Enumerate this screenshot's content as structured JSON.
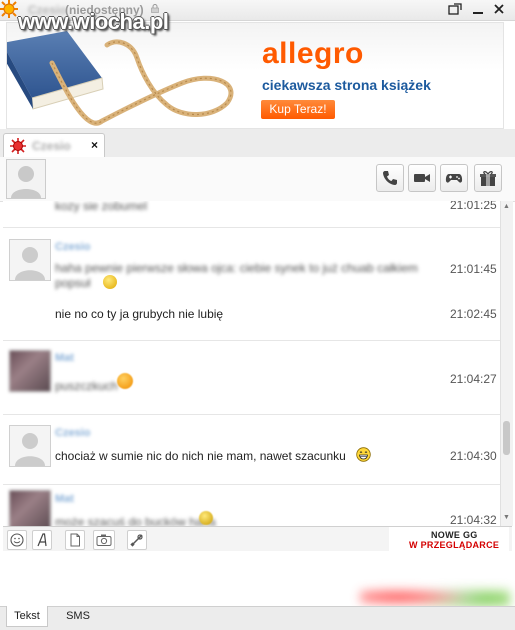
{
  "window": {
    "title_name": "Czesio",
    "title_status": "(niedostępny)"
  },
  "watermark": "www.wiocha.pl",
  "ad": {
    "brand": "allegro",
    "tagline": "ciekawsza strona książek",
    "button": "Kup Teraz!"
  },
  "tab": {
    "name": "Czesio",
    "close": "×"
  },
  "messages": [
    {
      "sender": "",
      "lines": [
        "kozy sie zobumel"
      ],
      "blurred": true,
      "time": "21:01:25",
      "avatar": "default"
    },
    {
      "sender": "Czesio",
      "lines": [
        "haha pewnie pierwsze słowa ojca: ciebie synek to już chuab całkiem",
        "popsuł"
      ],
      "blurred": true,
      "time": "21:01:45",
      "avatar": "default"
    },
    {
      "sender": "",
      "lines": [
        "nie no co ty ja grubych nie lubię"
      ],
      "blurred": false,
      "time": "21:02:45",
      "avatar": "none"
    },
    {
      "sender": "Mat",
      "lines": [
        "puszczkuch"
      ],
      "blurred": true,
      "time": "21:04:27",
      "avatar": "photo"
    },
    {
      "sender": "Czesio",
      "lines": [
        "chociaż w sumie nic do nich nie mam, nawet szacunku"
      ],
      "blurred": false,
      "time": "21:04:30",
      "avatar": "default"
    },
    {
      "sender": "Mat",
      "lines": [
        "może szacuś do bucków haha"
      ],
      "blurred": true,
      "time": "21:04:32",
      "avatar": "photo"
    }
  ],
  "toolbar": {
    "promo_line1": "NOWE GG",
    "promo_line2": "W PRZEGLĄDARCE"
  },
  "bottom_tabs": [
    "Tekst",
    "SMS"
  ],
  "colors": {
    "accent": "#ff5a00",
    "promo_red": "#d40000",
    "link_blue": "#1c5a9e"
  }
}
